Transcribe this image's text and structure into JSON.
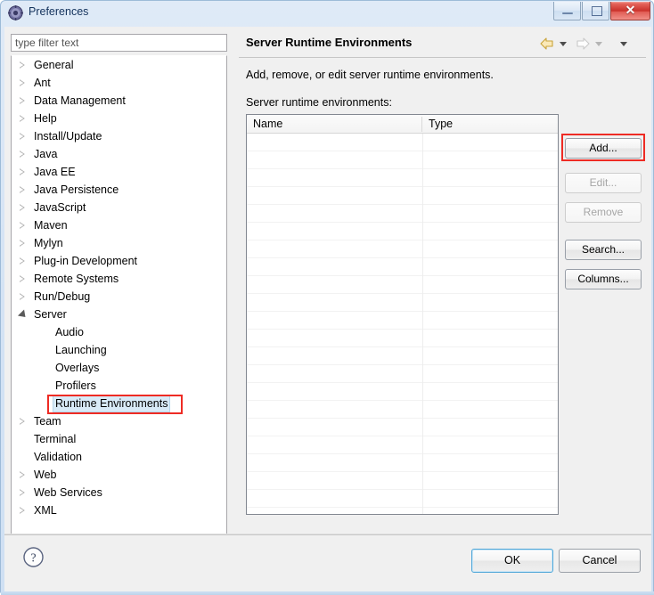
{
  "window": {
    "title": "Preferences",
    "icon": "preferences-gear-icon",
    "controls": {
      "minimize": "minimize-icon",
      "maximize": "maximize-icon",
      "close": "✕"
    }
  },
  "sidebar": {
    "filter": {
      "value": "",
      "placeholder": "type filter text"
    },
    "items": [
      {
        "label": "General",
        "indent": 0,
        "state": "collapsed",
        "selected": false
      },
      {
        "label": "Ant",
        "indent": 0,
        "state": "collapsed",
        "selected": false
      },
      {
        "label": "Data Management",
        "indent": 0,
        "state": "collapsed",
        "selected": false
      },
      {
        "label": "Help",
        "indent": 0,
        "state": "collapsed",
        "selected": false
      },
      {
        "label": "Install/Update",
        "indent": 0,
        "state": "collapsed",
        "selected": false
      },
      {
        "label": "Java",
        "indent": 0,
        "state": "collapsed",
        "selected": false
      },
      {
        "label": "Java EE",
        "indent": 0,
        "state": "collapsed",
        "selected": false
      },
      {
        "label": "Java Persistence",
        "indent": 0,
        "state": "collapsed",
        "selected": false
      },
      {
        "label": "JavaScript",
        "indent": 0,
        "state": "collapsed",
        "selected": false
      },
      {
        "label": "Maven",
        "indent": 0,
        "state": "collapsed",
        "selected": false
      },
      {
        "label": "Mylyn",
        "indent": 0,
        "state": "collapsed",
        "selected": false
      },
      {
        "label": "Plug-in Development",
        "indent": 0,
        "state": "collapsed",
        "selected": false
      },
      {
        "label": "Remote Systems",
        "indent": 0,
        "state": "collapsed",
        "selected": false
      },
      {
        "label": "Run/Debug",
        "indent": 0,
        "state": "collapsed",
        "selected": false
      },
      {
        "label": "Server",
        "indent": 0,
        "state": "expanded",
        "selected": false
      },
      {
        "label": "Audio",
        "indent": 1,
        "state": "leaf",
        "selected": false
      },
      {
        "label": "Launching",
        "indent": 1,
        "state": "leaf",
        "selected": false
      },
      {
        "label": "Overlays",
        "indent": 1,
        "state": "leaf",
        "selected": false
      },
      {
        "label": "Profilers",
        "indent": 1,
        "state": "leaf",
        "selected": false
      },
      {
        "label": "Runtime Environments",
        "indent": 1,
        "state": "leaf",
        "selected": true
      },
      {
        "label": "Team",
        "indent": 0,
        "state": "collapsed",
        "selected": false
      },
      {
        "label": "Terminal",
        "indent": 0,
        "state": "leaf",
        "selected": false
      },
      {
        "label": "Validation",
        "indent": 0,
        "state": "leaf",
        "selected": false
      },
      {
        "label": "Web",
        "indent": 0,
        "state": "collapsed",
        "selected": false
      },
      {
        "label": "Web Services",
        "indent": 0,
        "state": "collapsed",
        "selected": false
      },
      {
        "label": "XML",
        "indent": 0,
        "state": "collapsed",
        "selected": false
      }
    ]
  },
  "page": {
    "title": "Server Runtime Environments",
    "description": "Add, remove, or edit server runtime environments.",
    "table_label": "Server runtime environments:",
    "nav": {
      "back_icon": "back-arrow-icon",
      "back_menu_icon": "chevron-down-icon",
      "forward_icon": "forward-arrow-icon",
      "forward_menu_icon": "chevron-down-icon",
      "view_menu_icon": "chevron-down-icon"
    },
    "table": {
      "columns": [
        "Name",
        "Type"
      ],
      "rows": [],
      "empty_row_count": 21
    },
    "buttons": [
      {
        "label": "Add...",
        "enabled": true,
        "highlighted": true
      },
      {
        "label": "Edit...",
        "enabled": false,
        "highlighted": false
      },
      {
        "label": "Remove",
        "enabled": false,
        "highlighted": false
      },
      {
        "label": "Search...",
        "enabled": true,
        "highlighted": false
      },
      {
        "label": "Columns...",
        "enabled": true,
        "highlighted": false
      }
    ]
  },
  "footer": {
    "help_icon": "help-question-icon",
    "ok_label": "OK",
    "cancel_label": "Cancel"
  },
  "colors": {
    "highlight_red": "#ee2b24",
    "selection_blue": "#d8eaf7",
    "default_button_border": "#4ea6d8"
  }
}
